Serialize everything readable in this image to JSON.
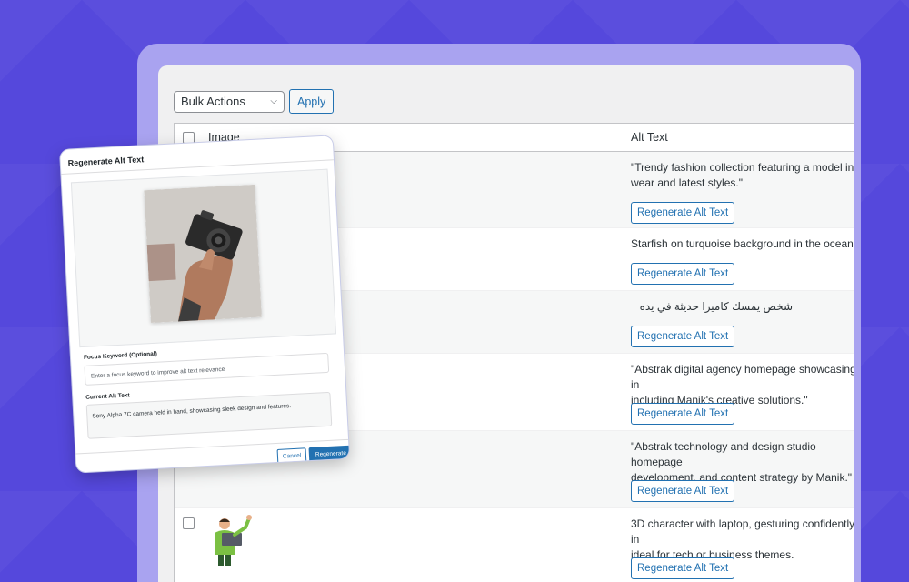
{
  "toolbar": {
    "bulk_actions": "Bulk Actions",
    "apply": "Apply"
  },
  "table": {
    "columns": {
      "image": "Image",
      "alt_text": "Alt Text"
    },
    "rows": [
      {
        "alt_text": "\"Trendy fashion collection featuring a model in a\nwear and latest styles.\"",
        "button": "Regenerate Alt Text"
      },
      {
        "alt_text": "Starfish on turquoise background in the ocean",
        "button": "Regenerate Alt Text"
      },
      {
        "alt_text": "شخص يمسك كاميرا حديثة في يده",
        "button": "Regenerate Alt Text"
      },
      {
        "alt_text": "\"Abstrak digital agency homepage showcasing in\nincluding Manik's creative solutions.\"",
        "button": "Regenerate Alt Text"
      },
      {
        "alt_text": "\"Abstrak technology and design studio homepage\ndevelopment, and content strategy by Manik.\"",
        "button": "Regenerate Alt Text"
      },
      {
        "alt_text": "3D character with laptop, gesturing confidently in\nideal for tech or business themes.",
        "button": "Regenerate Alt Text"
      }
    ]
  },
  "modal": {
    "title": "Regenerate Alt Text",
    "focus_label": "Focus Keyword (Optional)",
    "focus_placeholder": "Enter a focus keyword to improve alt text relevance",
    "current_label": "Current Alt Text",
    "current_value": "Sony Alpha 7C camera held in hand, showcasing sleek design and features.",
    "cancel": "Cancel",
    "regenerate": "Regenerate"
  },
  "colors": {
    "background": "#5548dc",
    "accent": "#2271b1"
  }
}
